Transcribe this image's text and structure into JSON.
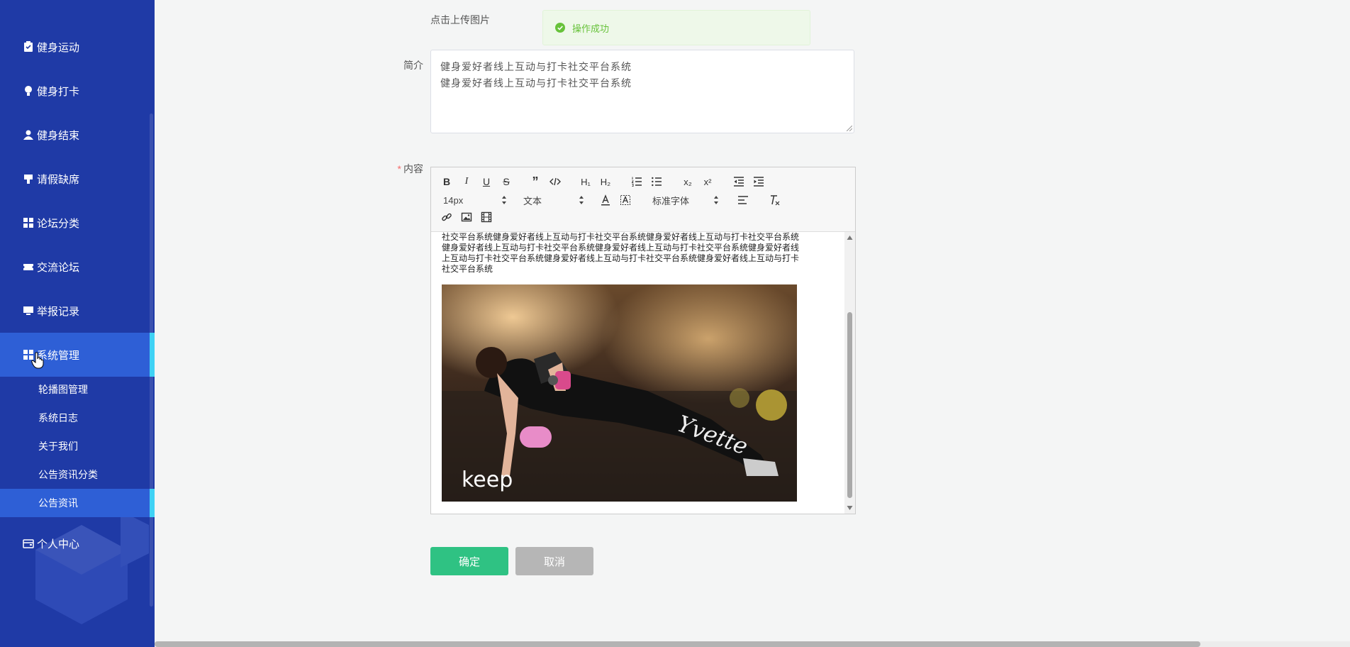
{
  "sidebar": {
    "items": [
      {
        "label": "健身运动",
        "icon": "clipboard-icon"
      },
      {
        "label": "健身打卡",
        "icon": "lightbulb-icon"
      },
      {
        "label": "健身结束",
        "icon": "user-icon"
      },
      {
        "label": "请假缺席",
        "icon": "stamp-icon"
      },
      {
        "label": "论坛分类",
        "icon": "grid-icon"
      },
      {
        "label": "交流论坛",
        "icon": "ticket-icon"
      },
      {
        "label": "举报记录",
        "icon": "monitor-icon"
      },
      {
        "label": "系统管理",
        "icon": "grid-icon",
        "active": true
      },
      {
        "label": "个人中心",
        "icon": "wallet-icon"
      }
    ],
    "sub_items": [
      {
        "label": "轮播图管理"
      },
      {
        "label": "系统日志"
      },
      {
        "label": "关于我们"
      },
      {
        "label": "公告资讯分类"
      },
      {
        "label": "公告资讯",
        "active": true
      }
    ]
  },
  "form": {
    "upload_text": "点击上传图片",
    "toast": "操作成功",
    "intro_label": "简介",
    "intro_lines": [
      "健身爱好者线上互动与打卡社交平台系统",
      "健身爱好者线上互动与打卡社交平台系统"
    ],
    "content_label": "内容",
    "required_mark": "*",
    "editor": {
      "font_size": "14px",
      "header_select": "文本",
      "font_family": "标准字体",
      "body_lines": [
        "社交平台系统健身爱好者线上互动与打卡社交平台系统健身爱好者线上互动与打卡社交平台系统",
        "健身爱好者线上互动与打卡社交平台系统健身爱好者线上互动与打卡社交平台系统健身爱好者线",
        "上互动与打卡社交平台系统健身爱好者线上互动与打卡社交平台系统健身爱好者线上互动与打卡",
        "社交平台系统"
      ],
      "photo_brand_1": "keep",
      "photo_brand_2": "Yvette"
    },
    "confirm": "确定",
    "cancel": "取消"
  },
  "colors": {
    "sidebar_bg": "#1f3aa6",
    "sidebar_active": "#2e5fd6",
    "active_indicator": "#3fd2f5",
    "confirm_button": "#2fc283",
    "cancel_button": "#b6b6b6",
    "toast_text": "#67c23a"
  }
}
